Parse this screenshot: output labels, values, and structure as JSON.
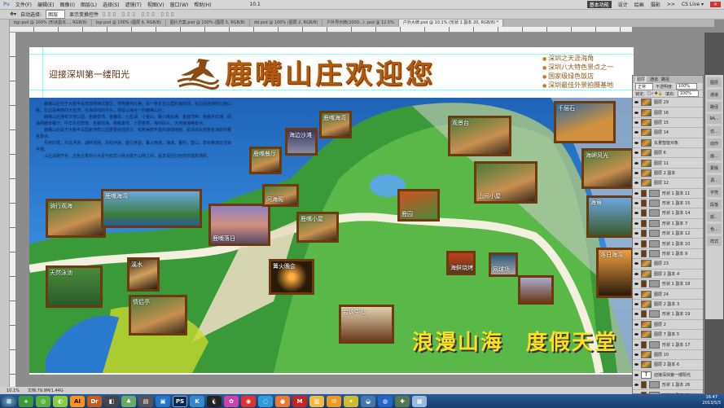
{
  "app": {
    "logo": "Ps",
    "menu": [
      "文件(F)",
      "编辑(E)",
      "图像(I)",
      "图层(L)",
      "选择(S)",
      "滤镜(T)",
      "视图(V)",
      "窗口(W)",
      "帮助(H)"
    ],
    "workspaces": [
      "基本功能",
      "设计",
      "绘画",
      "摄影",
      ">>",
      "CS Live ▾"
    ],
    "zoom_select": "10.1"
  },
  "options": {
    "auto_select_label": "自动选择:",
    "auto_select_value": "图层",
    "show_transform": "显示变换控件"
  },
  "tabs": [
    "bgi.psd @ 100% (形状副本..., RGB/8)",
    "bgi.psd @ 100% (图层 6, RGB/8)",
    "图片方案.psd @ 100% (图层 5, RGB/8)",
    "dd.psd @ 100% (图层 2, RGB/8)",
    "户外导示牌(2000...) .psd @ 12.5%",
    "户外大牌.psd @ 10.1% (形状 1 副本 20, RGB/8) *"
  ],
  "poster": {
    "slogan": "迎接深圳第一缕阳光",
    "title": "鹿嘴山庄欢迎您",
    "bullets": [
      "深圳之天涯海角",
      "深圳八大特色景点之一",
      "国家级绿色饭店",
      "深圳最佳外景拍摄基地"
    ],
    "intro": [
      "　　鹿嘴山庄位于大鹏半岛南澳杨梅坑景区，地势雄伟壮美，是一条长五公里的海岸线，右边是连绵的七娘山脉，左边是美丽的大亚湾，在海岸线的尽头，便是山海合一的鹿嘴山庄。",
      "　　鹿嘴山庄拥有汉地公园、金鹿銮湾、金鹿泉、七星湖、小金山、篝火晚会烤、金鹿湾畔、金鹿月石滩、闻海阁鹿景餐厅、中华东亚群落、金鹏观海、鹏鹏夏祥、十层香茶、海钓码头、天地接海等景点。",
      "　　鹿嘴山庄属于大鹏半岛国家地质公园重要组成部分，有着美丽丰富的海蚀地貌，是深圳东部黄金海岸的著名景点。",
      "　　月夜的鹭，外岛浮游，湖畔观网，协助冲浪，踏行黄昏，篝火晚烤，海滩，垂钓，登山，草目等游玩项目丰富。",
      "　　山庄设施齐全，古色古香的小木屋与欧式小院点缀于山林之间，是享受回归自然的理想场所。"
    ],
    "big_slogan": "浪漫山海　度假天堂"
  },
  "map_labels": [
    "骑行观海",
    "鹿嘴海湾",
    "鹿嘴落日",
    "问海阁",
    "鹿嘴餐厅",
    "海边沙滩",
    "鹿嘴海湾",
    "鹿嘴小屋",
    "溪水",
    "篝火晚会",
    "会议中心",
    "情侣亭",
    "天然泳池",
    "山间小屋",
    "千层石",
    "海岬风光",
    "海角",
    "落日海湾",
    "观景台",
    "网球场",
    "海鲜烧烤",
    "鹿园"
  ],
  "layers": {
    "tabs": [
      "图层",
      "通道",
      "路径"
    ],
    "blend": "正常",
    "opacity_label": "不透明度:",
    "opacity": "100%",
    "lock_label": "锁定:",
    "fill_label": "填充:",
    "fill": "100%",
    "items": [
      {
        "t": "img",
        "n": "图层 29"
      },
      {
        "t": "img",
        "n": "图层 16"
      },
      {
        "t": "img",
        "n": "图层 15"
      },
      {
        "t": "img",
        "n": "图层 14"
      },
      {
        "t": "img",
        "n": "矢量智能对象"
      },
      {
        "t": "img",
        "n": "图层 6"
      },
      {
        "t": "img",
        "n": "图层 11"
      },
      {
        "t": "img",
        "n": "图层 2 副本"
      },
      {
        "t": "img",
        "n": "图层 12"
      },
      {
        "t": "shape",
        "n": "形状 1 副本 11"
      },
      {
        "t": "shape",
        "n": "形状 1 副本 15"
      },
      {
        "t": "shape",
        "n": "形状 1 副本 14"
      },
      {
        "t": "shape",
        "n": "形状 1 副本 7"
      },
      {
        "t": "shape",
        "n": "形状 1 副本 12"
      },
      {
        "t": "shape",
        "n": "形状 1 副本 10"
      },
      {
        "t": "shape",
        "n": "形状 1 副本 9"
      },
      {
        "t": "img",
        "n": "图层 23"
      },
      {
        "t": "img",
        "n": "图层 2 副本 4"
      },
      {
        "t": "shape",
        "n": "形状 1 副本 18"
      },
      {
        "t": "img",
        "n": "图层 24"
      },
      {
        "t": "img",
        "n": "图层 2 副本 3"
      },
      {
        "t": "shape",
        "n": "形状 1 副本 19"
      },
      {
        "t": "img",
        "n": "图层 2"
      },
      {
        "t": "img",
        "n": "图层 7 副本 5"
      },
      {
        "t": "shape",
        "n": "形状 1 副本 17"
      },
      {
        "t": "img",
        "n": "图层 10"
      },
      {
        "t": "img",
        "n": "图层 2 副本 6"
      },
      {
        "t": "text",
        "n": "迎接深圳第一缕阳光"
      },
      {
        "t": "shape",
        "n": "形状 1 副本 26"
      },
      {
        "t": "shape",
        "n": "形状 1 副本 25"
      }
    ]
  },
  "dock": [
    "图层",
    "通道",
    "路径",
    "9A...",
    "仿...",
    "动作",
    "画...",
    "蒙版",
    "调...",
    "字符",
    "段落",
    "颜...",
    "色...",
    "样式"
  ],
  "status": {
    "zoom": "10.1%",
    "doc": "文档:79.9M/1.44G"
  },
  "taskbar": {
    "apps": [
      "AI",
      "Dr",
      "PS",
      "M"
    ],
    "time": "16:47",
    "date": "2013/5/3"
  },
  "colors": {
    "accent": "#b05a10",
    "frame": "#6b3a0e",
    "sea": "#2a7ad0",
    "land": "#3a9a3a"
  }
}
